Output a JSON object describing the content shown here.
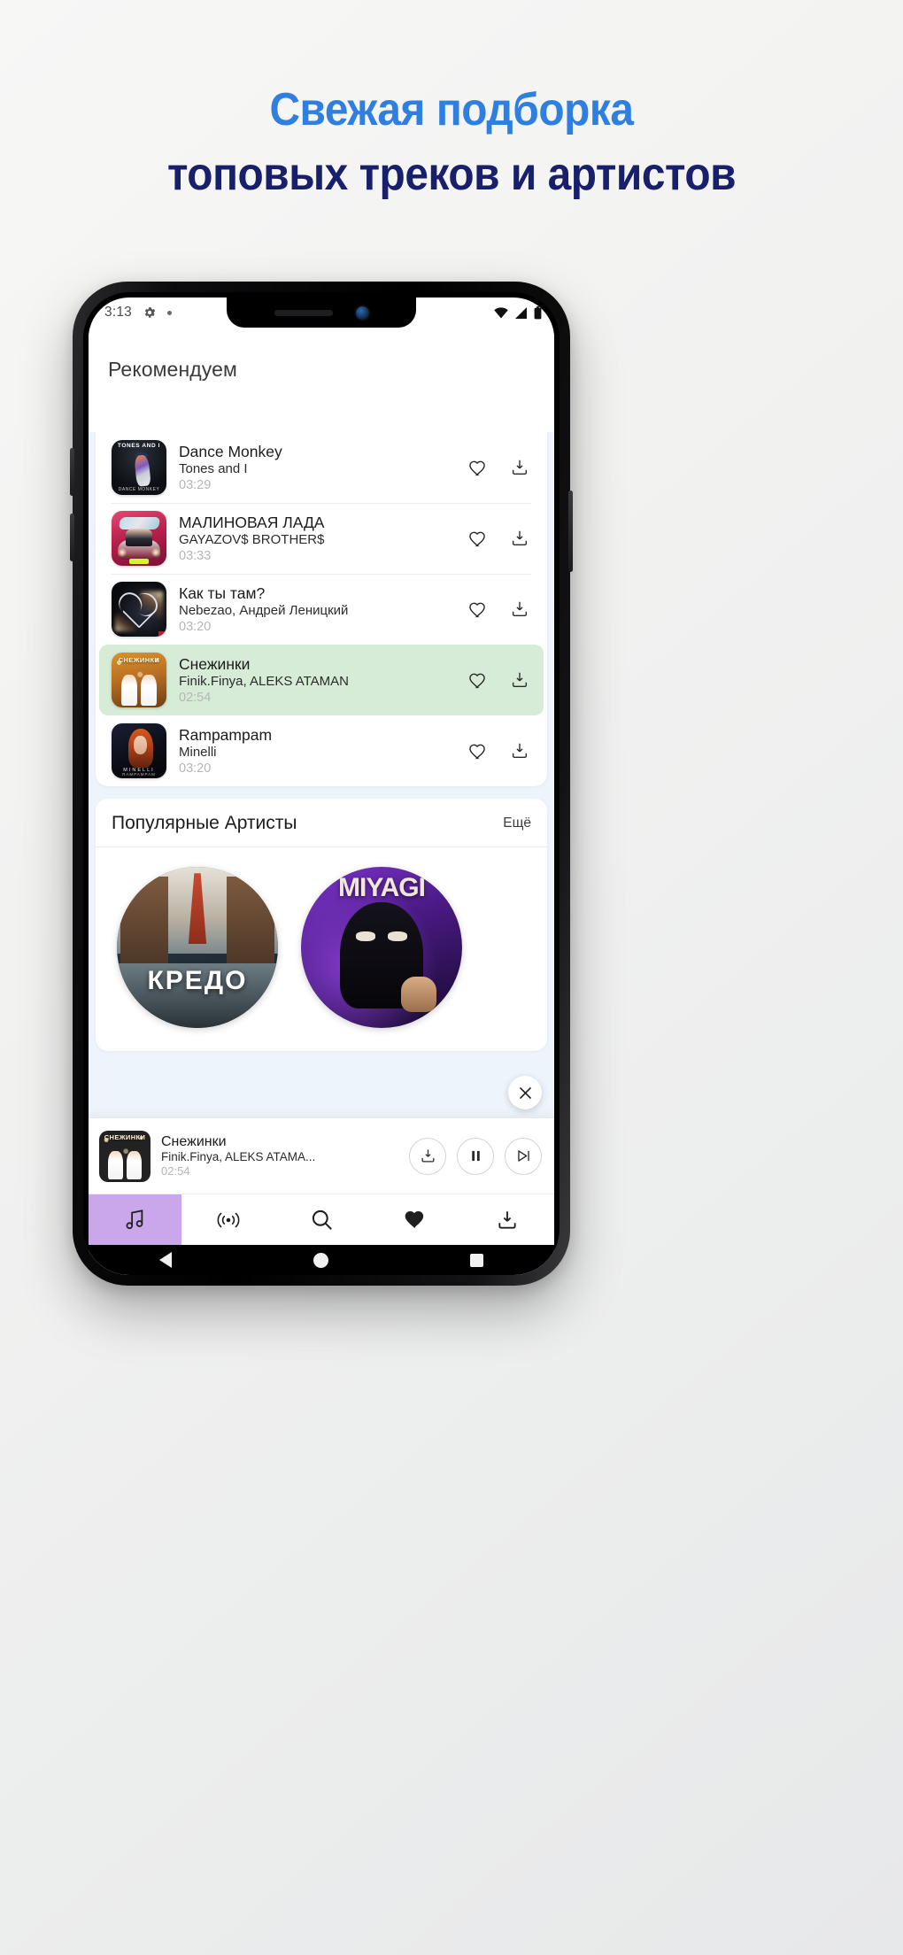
{
  "headline": {
    "line1": "Свежая подборка",
    "line2": "топовых треков и артистов",
    "line1_color": "#2f7fe0",
    "line2_color": "#18206b"
  },
  "status_bar": {
    "time": "3:13",
    "gear_icon": "gear-icon",
    "dot_icon": "dot-indicator",
    "wifi_icon": "wifi-icon",
    "signal_icon": "cellular-signal-icon",
    "battery_icon": "battery-icon"
  },
  "app": {
    "header_title": "Рекомендуем"
  },
  "tracks": [
    {
      "title": "Dance Monkey",
      "artist": "Tones and I",
      "duration": "03:29",
      "active": false,
      "art": "art-dm",
      "cover_top_text": "TONES AND I",
      "cover_bottom_text": "DANCE MONKEY"
    },
    {
      "title": "МАЛИНОВАЯ ЛАДА",
      "artist": "GAYAZOV$ BROTHER$",
      "duration": "03:33",
      "active": false,
      "art": "art-lada",
      "cover_top_text": "",
      "cover_bottom_text": ""
    },
    {
      "title": "Как ты там?",
      "artist": "Nebezao, Андрей Леницкий",
      "duration": "03:20",
      "active": false,
      "art": "art-kak",
      "cover_top_text": "",
      "cover_bottom_text": ""
    },
    {
      "title": "Снежинки",
      "artist": "Finik.Finya, ALEKS ATAMAN",
      "duration": "02:54",
      "active": true,
      "art": "art-snow",
      "cover_top_text": "СНЕЖИНКИ",
      "cover_bottom_text": ""
    },
    {
      "title": "Rampampam",
      "artist": "Minelli",
      "duration": "03:20",
      "active": false,
      "art": "art-ramp",
      "cover_top_text": "",
      "cover_bottom_text": "MINELLI"
    }
  ],
  "track_row_icons": {
    "like": "heart-outline-icon",
    "download": "download-icon"
  },
  "artists_section": {
    "title": "Популярные Артисты",
    "more_label": "Ещё",
    "artists": [
      {
        "name": "КРЕДО",
        "art": "art-kredo"
      },
      {
        "name": "MIYAGI",
        "art": "art-miyagi"
      }
    ]
  },
  "mini_player": {
    "title": "Снежинки",
    "artist": "Finik.Finya, ALEKS ATAMA...",
    "duration": "02:54",
    "download_icon": "download-icon",
    "pause_icon": "pause-icon",
    "next_icon": "next-track-icon",
    "close_icon": "close-icon",
    "cover_text": "СНЕЖИНКИ",
    "highlight_color": "#d7ecd7"
  },
  "bottom_nav": {
    "active_color": "#c9a7ea",
    "items": [
      {
        "icon": "music-note-icon",
        "name": "nav-music",
        "active": true
      },
      {
        "icon": "radio-waves-icon",
        "name": "nav-radio",
        "active": false
      },
      {
        "icon": "search-icon",
        "name": "nav-search",
        "active": false
      },
      {
        "icon": "heart-filled-icon",
        "name": "nav-favorites",
        "active": false
      },
      {
        "icon": "download-icon",
        "name": "nav-downloads",
        "active": false
      }
    ]
  },
  "android_nav": {
    "back": "back-triangle-icon",
    "home": "home-circle-icon",
    "recents": "recents-square-icon"
  }
}
